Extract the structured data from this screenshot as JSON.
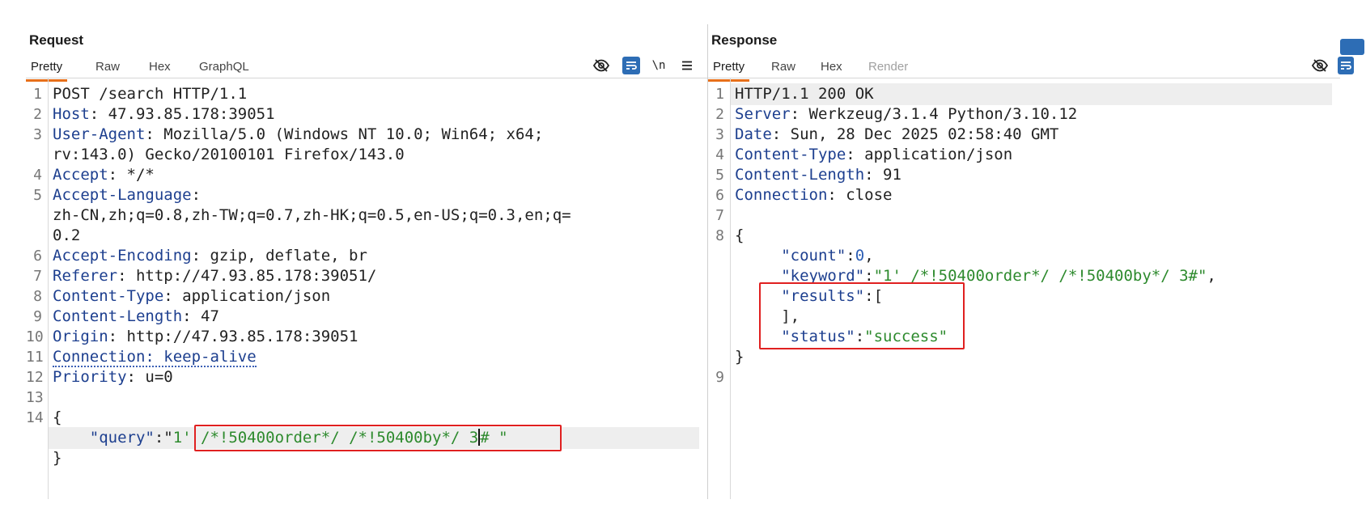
{
  "request": {
    "title": "Request",
    "tabs": [
      "Pretty",
      "Raw",
      "Hex",
      "GraphQL"
    ],
    "active_tab": "Pretty",
    "toolbar": {
      "hide_icon": "eye-slash-icon",
      "wrap_icon": "wrap-lines-icon",
      "newline_label": "\\n",
      "menu_icon": "menu-icon"
    },
    "lines": [
      {
        "n": "1",
        "parts": [
          {
            "t": "POST /search HTTP/1.1",
            "c": "plain"
          }
        ]
      },
      {
        "n": "2",
        "parts": [
          {
            "t": "Host",
            "c": "hk"
          },
          {
            "t": ": 47.93.85.178:39051",
            "c": "plain"
          }
        ]
      },
      {
        "n": "3",
        "parts": [
          {
            "t": "User-Agent",
            "c": "hk"
          },
          {
            "t": ": Mozilla/5.0 (Windows NT 10.0; Win64; x64;",
            "c": "plain"
          }
        ]
      },
      {
        "n": "",
        "parts": [
          {
            "t": "rv:143.0) Gecko/20100101 Firefox/143.0",
            "c": "plain"
          }
        ]
      },
      {
        "n": "4",
        "parts": [
          {
            "t": "Accept",
            "c": "hk"
          },
          {
            "t": ": */*",
            "c": "plain"
          }
        ]
      },
      {
        "n": "5",
        "parts": [
          {
            "t": "Accept-Language",
            "c": "hk"
          },
          {
            "t": ":",
            "c": "plain"
          }
        ]
      },
      {
        "n": "",
        "parts": [
          {
            "t": "zh-CN,zh;q=0.8,zh-TW;q=0.7,zh-HK;q=0.5,en-US;q=0.3,en;q=",
            "c": "plain"
          }
        ]
      },
      {
        "n": "",
        "parts": [
          {
            "t": "0.2",
            "c": "plain"
          }
        ]
      },
      {
        "n": "6",
        "parts": [
          {
            "t": "Accept-Encoding",
            "c": "hk"
          },
          {
            "t": ": gzip, deflate, br",
            "c": "plain"
          }
        ]
      },
      {
        "n": "7",
        "parts": [
          {
            "t": "Referer",
            "c": "hk"
          },
          {
            "t": ": http://47.93.85.178:39051/",
            "c": "plain"
          }
        ]
      },
      {
        "n": "8",
        "parts": [
          {
            "t": "Content-Type",
            "c": "hk"
          },
          {
            "t": ": application/json",
            "c": "plain"
          }
        ]
      },
      {
        "n": "9",
        "parts": [
          {
            "t": "Content-Length",
            "c": "hk"
          },
          {
            "t": ": 47",
            "c": "plain"
          }
        ]
      },
      {
        "n": "10",
        "parts": [
          {
            "t": "Origin",
            "c": "hk"
          },
          {
            "t": ": http://47.93.85.178:39051",
            "c": "plain"
          }
        ]
      },
      {
        "n": "11",
        "parts": [
          {
            "t": "Connection: keep-alive",
            "c": "hk-dotted"
          }
        ]
      },
      {
        "n": "12",
        "parts": [
          {
            "t": "Priority",
            "c": "hk"
          },
          {
            "t": ": u=0",
            "c": "plain"
          }
        ]
      },
      {
        "n": "13",
        "parts": []
      },
      {
        "n": "14",
        "parts": [
          {
            "t": "{",
            "c": "plain"
          }
        ]
      },
      {
        "n": "",
        "parts": [
          {
            "t": "    \"query\"",
            "c": "jk"
          },
          {
            "t": ":\"",
            "c": "plain"
          },
          {
            "t": "1' /*!50400order*/ /*!50400by*/ 3",
            "c": "jv"
          },
          {
            "t": "#",
            "c": "cursor-after"
          },
          {
            "t": " \"",
            "c": "jv"
          }
        ]
      },
      {
        "n": "",
        "parts": [
          {
            "t": "}",
            "c": "plain"
          }
        ]
      }
    ]
  },
  "response": {
    "title": "Response",
    "tabs": [
      "Pretty",
      "Raw",
      "Hex",
      "Render"
    ],
    "active_tab": "Pretty",
    "toolbar": {
      "hide_icon": "eye-slash-icon",
      "wrap_icon": "wrap-lines-icon"
    },
    "lines": [
      {
        "n": "1",
        "parts": [
          {
            "t": "HTTP/1.1 200 OK",
            "c": "plain"
          }
        ]
      },
      {
        "n": "2",
        "parts": [
          {
            "t": "Server",
            "c": "hk"
          },
          {
            "t": ": Werkzeug/3.1.4 Python/3.10.12",
            "c": "plain"
          }
        ]
      },
      {
        "n": "3",
        "parts": [
          {
            "t": "Date",
            "c": "hk"
          },
          {
            "t": ": Sun, 28 Dec 2025 02:58:40 GMT",
            "c": "plain"
          }
        ]
      },
      {
        "n": "4",
        "parts": [
          {
            "t": "Content-Type",
            "c": "hk"
          },
          {
            "t": ": application/json",
            "c": "plain"
          }
        ]
      },
      {
        "n": "5",
        "parts": [
          {
            "t": "Content-Length",
            "c": "hk"
          },
          {
            "t": ": 91",
            "c": "plain"
          }
        ]
      },
      {
        "n": "6",
        "parts": [
          {
            "t": "Connection",
            "c": "hk"
          },
          {
            "t": ": close",
            "c": "plain"
          }
        ]
      },
      {
        "n": "7",
        "parts": []
      },
      {
        "n": "8",
        "parts": [
          {
            "t": "{",
            "c": "plain"
          }
        ]
      },
      {
        "n": "",
        "parts": [
          {
            "t": "     \"count\"",
            "c": "jk"
          },
          {
            "t": ":",
            "c": "plain"
          },
          {
            "t": "0",
            "c": "jn"
          },
          {
            "t": ",",
            "c": "plain"
          }
        ]
      },
      {
        "n": "",
        "parts": [
          {
            "t": "     \"keyword\"",
            "c": "jk"
          },
          {
            "t": ":",
            "c": "plain"
          },
          {
            "t": "\"1' /*!50400order*/ /*!50400by*/ 3#\"",
            "c": "jv"
          },
          {
            "t": ",",
            "c": "plain"
          }
        ]
      },
      {
        "n": "",
        "parts": [
          {
            "t": "     \"results\"",
            "c": "jk"
          },
          {
            "t": ":[",
            "c": "plain"
          }
        ]
      },
      {
        "n": "",
        "parts": [
          {
            "t": "     ],",
            "c": "plain"
          }
        ]
      },
      {
        "n": "",
        "parts": [
          {
            "t": "     \"status\"",
            "c": "jk"
          },
          {
            "t": ":",
            "c": "plain"
          },
          {
            "t": "\"success\"",
            "c": "jv"
          }
        ]
      },
      {
        "n": "",
        "parts": [
          {
            "t": "}",
            "c": "plain"
          }
        ]
      },
      {
        "n": "9",
        "parts": []
      }
    ]
  },
  "colors": {
    "accent": "#e8701a",
    "header_key": "#1d3f8f",
    "json_string": "#2d8a2d",
    "highlight_box": "#e02020",
    "wrap_button": "#2d6db5"
  }
}
